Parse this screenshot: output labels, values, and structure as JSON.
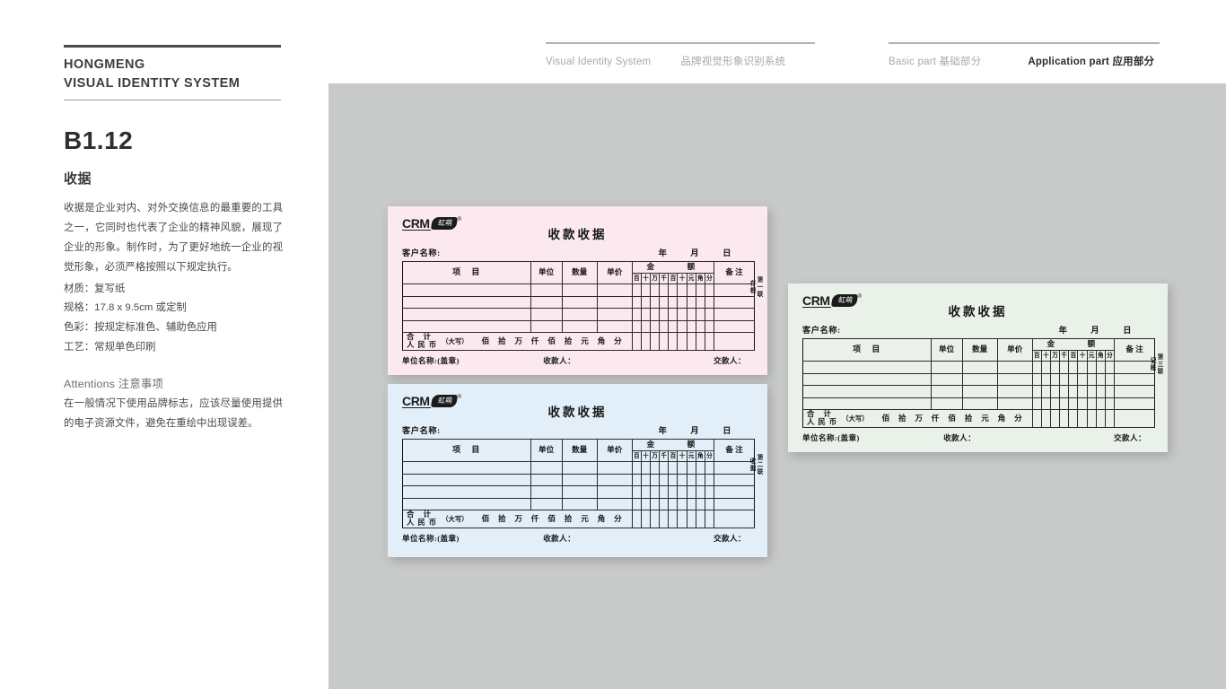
{
  "brand": {
    "line1": "HONGMENG",
    "line2": "VISUAL IDENTITY SYSTEM"
  },
  "header": {
    "group1": [
      {
        "label": "Visual Identity System"
      },
      {
        "label": "品牌视觉形象识别系统"
      }
    ],
    "group2": [
      {
        "label": "Basic part 基础部分",
        "active": false
      },
      {
        "label": "Application part 应用部分",
        "active": true
      }
    ]
  },
  "sidebar": {
    "code": "B1.12",
    "subtitle": "收据",
    "paragraph": "收据是企业对内、对外交换信息的最重要的工具之一，它同时也代表了企业的精神风貌，展现了企业的形象。制作时，为了更好地统一企业的视觉形象，必须严格按照以下规定执行。",
    "specs": [
      "材质：复写纸",
      "规格：17.8 x 9.5cm 或定制",
      "色彩：按规定标准色、辅助色应用",
      "工艺：常规单色印刷"
    ],
    "attentions_title": "Attentions 注意事项",
    "attentions_body": "在一般情况下使用品牌标志，应该尽量使用提供的电子资源文件，避免在重绘中出现误差。"
  },
  "receipt_common": {
    "logo_text": "CRM",
    "logo_badge": "虹萌",
    "logo_reg": "®",
    "title": "收款收据",
    "customer_label": "客户名称:",
    "date_parts": [
      "年",
      "月",
      "日"
    ],
    "columns": {
      "item": "项      目",
      "unit": "单位",
      "qty": "数量",
      "price": "单价",
      "amount_left": "金",
      "amount_right": "额",
      "remark": "备 注"
    },
    "amount_digits": [
      "百",
      "十",
      "万",
      "千",
      "百",
      "十",
      "元",
      "角",
      "分"
    ],
    "data_rows": 4,
    "total_label_line1": "合    计",
    "total_label_line2": "人民币",
    "total_label_note": "（大写）",
    "total_units": [
      "佰",
      "拾",
      "万",
      "仟",
      "佰",
      "拾",
      "元",
      "角",
      "分"
    ],
    "footer": {
      "unit_name": "单位名称:(盖章)",
      "payee": "收款人：",
      "payer": "交款人："
    }
  },
  "receipts": [
    {
      "name": "copy-1-stub",
      "color": "#fbe9ef",
      "copy_label": "第一联",
      "copy_use": "存根"
    },
    {
      "name": "copy-2-receipt",
      "color": "#e2eff8",
      "copy_label": "第二联",
      "copy_use": "收据"
    },
    {
      "name": "copy-3-bookkeep",
      "color": "#e9f1e9",
      "copy_label": "第三联",
      "copy_use": "记账"
    }
  ],
  "colors": {
    "canvas": "#c8cac9",
    "page": "#ffffff",
    "rule_dark": "#4a4a4a",
    "rule_light": "#b4b4b4",
    "text_dark": "#2b2b2b",
    "text_muted": "#a8a8a8"
  }
}
